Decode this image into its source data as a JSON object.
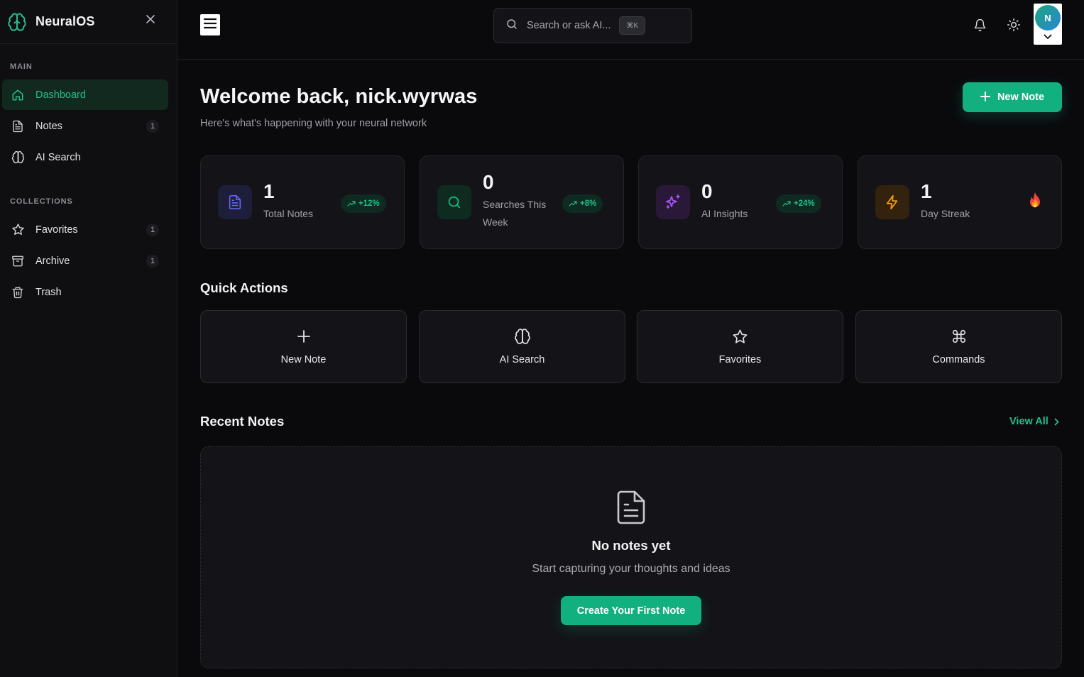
{
  "brand": {
    "name": "NeuralOS",
    "icon": "brain-icon"
  },
  "sidebar": {
    "sections": [
      {
        "label": "MAIN",
        "items": [
          {
            "label": "Dashboard",
            "icon": "home-icon",
            "active": true
          },
          {
            "label": "Notes",
            "icon": "file-text-icon",
            "count": "1"
          },
          {
            "label": "AI Search",
            "icon": "brain-icon"
          }
        ]
      },
      {
        "label": "COLLECTIONS",
        "items": [
          {
            "label": "Favorites",
            "icon": "star-icon",
            "count": "1"
          },
          {
            "label": "Archive",
            "icon": "archive-icon",
            "count": "1"
          },
          {
            "label": "Trash",
            "icon": "trash-icon"
          }
        ]
      }
    ]
  },
  "topbar": {
    "search": {
      "placeholder": "Search or ask AI...",
      "shortcut": "⌘K"
    },
    "avatar_initial": "N"
  },
  "main": {
    "welcome": "Welcome back, nick.wyrwas",
    "subtitle": "Here's what's happening with your neural network",
    "new_note_label": "New Note",
    "stats": [
      {
        "value": "1",
        "label": "Total Notes",
        "trend": "+12%",
        "icon": "file-text-icon",
        "color": "#6366f1"
      },
      {
        "value": "0",
        "label": "Searches This Week",
        "trend": "+8%",
        "icon": "search-icon",
        "color": "#10b981"
      },
      {
        "value": "0",
        "label": "AI Insights",
        "trend": "+24%",
        "icon": "sparkles-icon",
        "color": "#a855f7"
      },
      {
        "value": "1",
        "label": "Day Streak",
        "icon": "zap-icon",
        "color": "#f59e0b",
        "badge": "fire-icon"
      }
    ],
    "quick_actions_title": "Quick Actions",
    "quick_actions": [
      {
        "label": "New Note",
        "icon": "plus-icon"
      },
      {
        "label": "AI Search",
        "icon": "brain-icon"
      },
      {
        "label": "Favorites",
        "icon": "star-icon"
      },
      {
        "label": "Commands",
        "icon": "command-icon"
      }
    ],
    "recent_title": "Recent Notes",
    "view_all": "View All",
    "empty": {
      "title": "No notes yet",
      "subtitle": "Start capturing your thoughts and ideas",
      "button": "Create Your First Note"
    }
  },
  "colors": {
    "accent": "#12b07e",
    "background": "#0a0a0d",
    "card": "#141418"
  }
}
